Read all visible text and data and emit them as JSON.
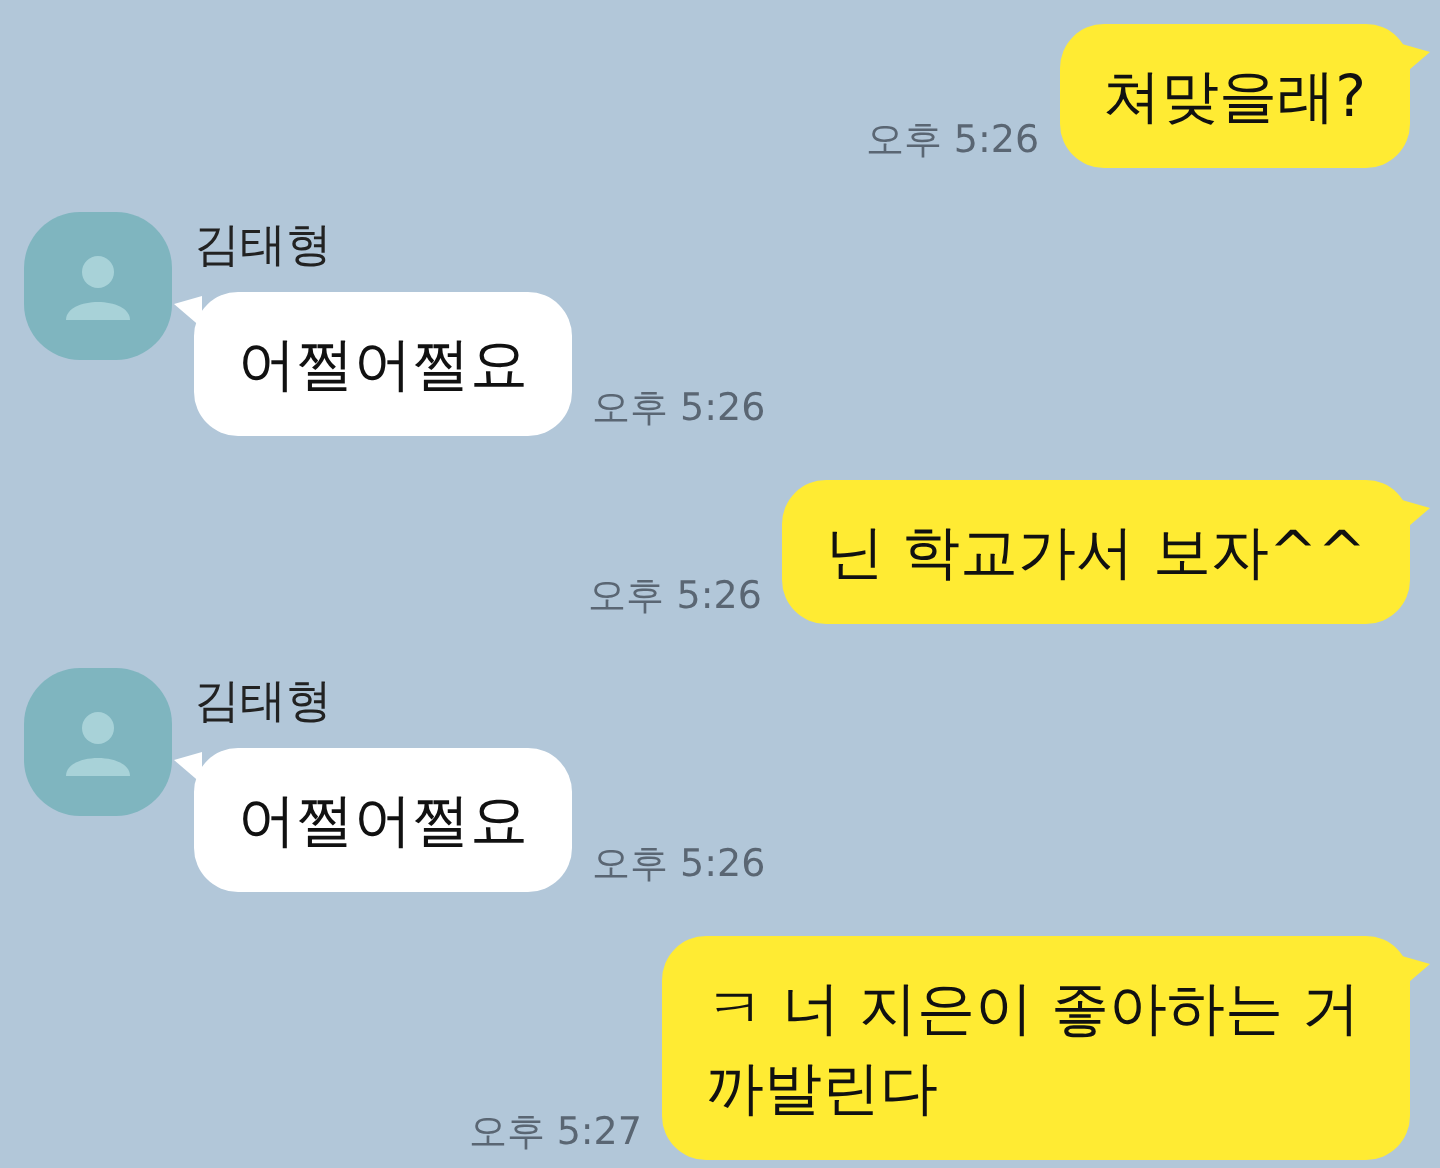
{
  "messages": [
    {
      "kind": "sent",
      "text": "쳐맞을래?",
      "time": "오후 5:26"
    },
    {
      "kind": "received",
      "sender": "김태형",
      "text": "어쩔어쩔요",
      "time": "오후 5:26"
    },
    {
      "kind": "sent",
      "text": "닌 학교가서 보자^^",
      "time": "오후 5:26"
    },
    {
      "kind": "received",
      "sender": "김태형",
      "text": "어쩔어쩔요",
      "time": "오후 5:26"
    },
    {
      "kind": "sent",
      "text": "ㅋ 너 지은이 좋아하는 거 까발린다",
      "time": "오후 5:27"
    }
  ]
}
